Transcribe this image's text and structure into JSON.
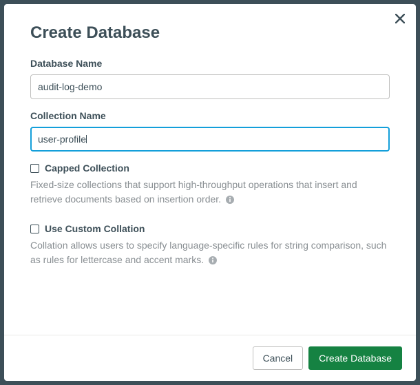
{
  "modal": {
    "title": "Create Database",
    "fields": {
      "dbName": {
        "label": "Database Name",
        "value": "audit-log-demo"
      },
      "collName": {
        "label": "Collection Name",
        "value": "user-profile"
      }
    },
    "options": {
      "capped": {
        "label": "Capped Collection",
        "help": "Fixed-size collections that support high-throughput operations that insert and retrieve documents based on insertion order."
      },
      "collation": {
        "label": "Use Custom Collation",
        "help": "Collation allows users to specify language-specific rules for string comparison, such as rules for lettercase and accent marks."
      }
    },
    "buttons": {
      "cancel": "Cancel",
      "submit": "Create Database"
    }
  }
}
